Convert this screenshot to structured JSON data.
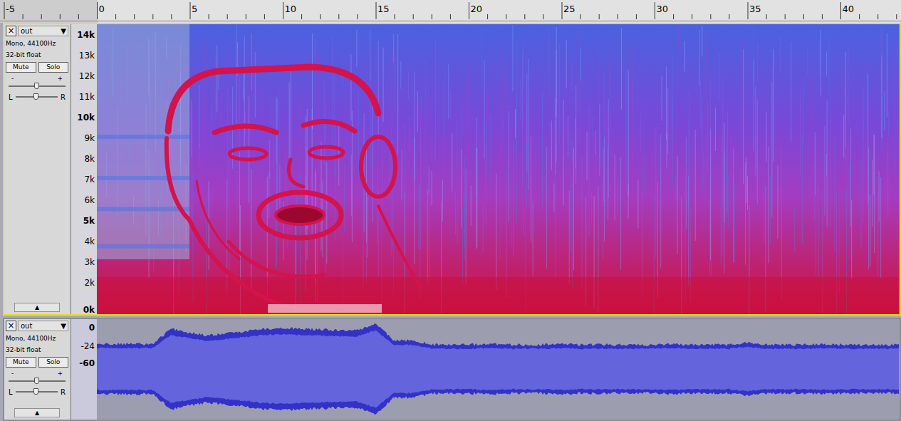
{
  "ruler": {
    "ticks": [
      "-5",
      "0",
      "5",
      "10",
      "15",
      "20",
      "25",
      "30",
      "35",
      "40"
    ]
  },
  "tracks": [
    {
      "kind": "spectrogram",
      "name": "out",
      "close": "×",
      "menu": "▼",
      "format": "Mono, 44100Hz",
      "sample": "32-bit float",
      "selected": true,
      "buttons": [
        {
          "label": "Mute",
          "pressed": false
        },
        {
          "label": "Solo",
          "pressed": false
        }
      ],
      "gain": {
        "min": "-",
        "max": "+",
        "level": 0.5
      },
      "pan": {
        "left": "L",
        "right": "R",
        "level": 0.5
      },
      "collapse": "▲",
      "scale": [
        {
          "label": "14k",
          "value": 14,
          "bold": true
        },
        {
          "label": "13k",
          "value": 13,
          "bold": false
        },
        {
          "label": "12k",
          "value": 12,
          "bold": false
        },
        {
          "label": "11k",
          "value": 11,
          "bold": false
        },
        {
          "label": "10k",
          "value": 10,
          "bold": true
        },
        {
          "label": "9k",
          "value": 9,
          "bold": false
        },
        {
          "label": "8k",
          "value": 8,
          "bold": false
        },
        {
          "label": "7k",
          "value": 7,
          "bold": false
        },
        {
          "label": "6k",
          "value": 6,
          "bold": false
        },
        {
          "label": "5k",
          "value": 5,
          "bold": true
        },
        {
          "label": "4k",
          "value": 4,
          "bold": false
        },
        {
          "label": "3k",
          "value": 3,
          "bold": false
        },
        {
          "label": "2k",
          "value": 2,
          "bold": false
        },
        {
          "label": "0k",
          "value": 0,
          "bold": true
        }
      ]
    },
    {
      "kind": "waveform",
      "name": "out",
      "close": "×",
      "menu": "▼",
      "format": "Mono, 44100Hz",
      "sample": "32-bit float",
      "selected": false,
      "buttons": [
        {
          "label": "Mute",
          "pressed": false
        },
        {
          "label": "Solo",
          "pressed": false
        }
      ],
      "gain": {
        "min": "-",
        "max": "+",
        "level": 0.5
      },
      "pan": {
        "left": "L",
        "right": "R",
        "level": 0.5
      },
      "collapse": "▲",
      "scale": [
        {
          "label": "0",
          "value": 0,
          "bold": true
        },
        {
          "label": "-24",
          "value": -24,
          "bold": false
        },
        {
          "label": "-60",
          "value": -60,
          "bold": true
        }
      ],
      "envelope": [
        -29,
        -29,
        -29,
        -29,
        -9,
        -14,
        -18,
        -15,
        -12,
        -9,
        -8,
        -9,
        -10,
        -11,
        -11,
        -2,
        -25,
        -24,
        -30,
        -30,
        -30,
        -29,
        -30,
        -30,
        -30,
        -29,
        -30,
        -30,
        -30,
        -30,
        -30,
        -29,
        -30,
        -30,
        -30,
        -27,
        -30,
        -30,
        -30,
        -29,
        -30,
        -30,
        -30,
        -30
      ]
    }
  ]
}
